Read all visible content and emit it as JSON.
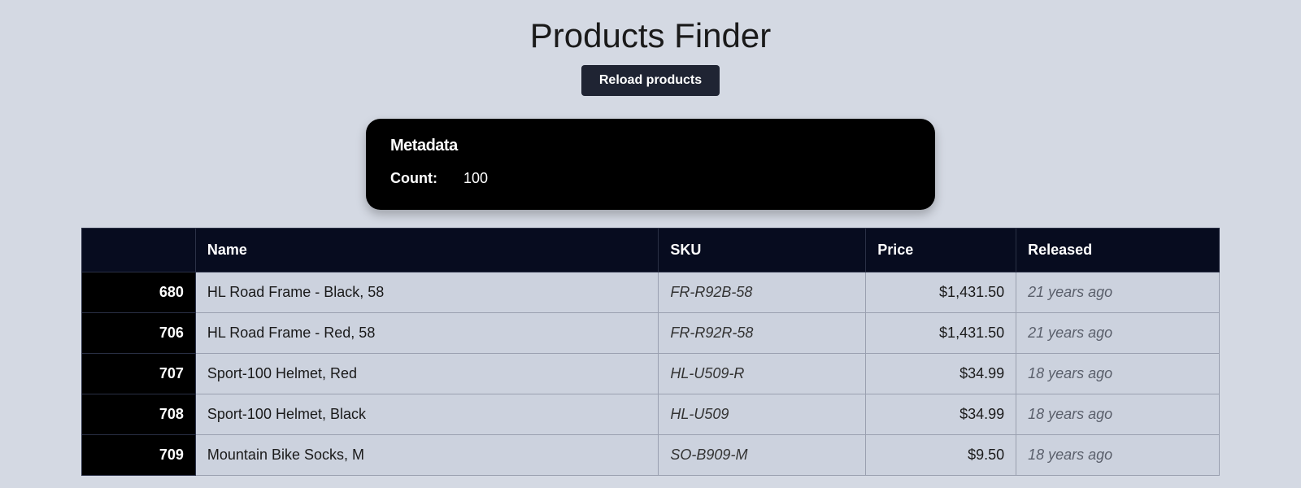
{
  "header": {
    "title": "Products Finder",
    "reload_label": "Reload products"
  },
  "metadata": {
    "title": "Metadata",
    "count_label": "Count:",
    "count_value": "100"
  },
  "table": {
    "columns": {
      "id": "",
      "name": "Name",
      "sku": "SKU",
      "price": "Price",
      "released": "Released"
    },
    "rows": [
      {
        "id": "680",
        "name": "HL Road Frame - Black, 58",
        "sku": "FR-R92B-58",
        "price": "$1,431.50",
        "released": "21 years ago"
      },
      {
        "id": "706",
        "name": "HL Road Frame - Red, 58",
        "sku": "FR-R92R-58",
        "price": "$1,431.50",
        "released": "21 years ago"
      },
      {
        "id": "707",
        "name": "Sport-100 Helmet, Red",
        "sku": "HL-U509-R",
        "price": "$34.99",
        "released": "18 years ago"
      },
      {
        "id": "708",
        "name": "Sport-100 Helmet, Black",
        "sku": "HL-U509",
        "price": "$34.99",
        "released": "18 years ago"
      },
      {
        "id": "709",
        "name": "Mountain Bike Socks, M",
        "sku": "SO-B909-M",
        "price": "$9.50",
        "released": "18 years ago"
      }
    ]
  }
}
